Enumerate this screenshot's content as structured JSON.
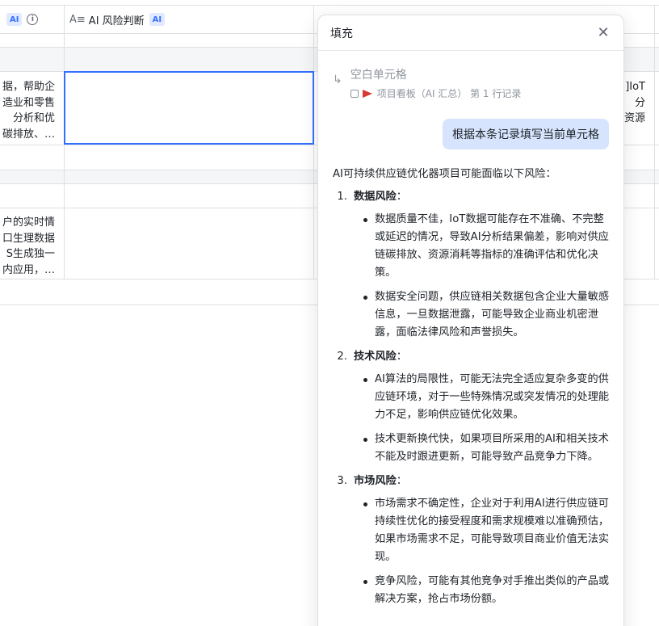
{
  "table": {
    "columns": [
      {
        "label": "",
        "badge": "AI"
      },
      {
        "label": "AI 风险判断",
        "badge": "AI"
      }
    ],
    "rows": [
      {
        "col1_lines": [
          "据，帮助企",
          "造业和零售",
          "分析和优",
          "碳排放、…"
        ],
        "col_right_lines": [
          "]IoT",
          "分",
          "资源"
        ]
      },
      {
        "col1_lines": [
          "户的实时情",
          "口生理数据",
          "S生成独一",
          "内应用，…"
        ]
      }
    ]
  },
  "panel": {
    "title": "填充",
    "reference": {
      "title": "空白单元格",
      "source": "项目看板（AI 汇总）  第 1 行记录"
    },
    "user_message": "根据本条记录填写当前单元格",
    "answer": {
      "intro": "AI可持续供应链优化器项目可能面临以下风险：",
      "sections": [
        {
          "num": "1.",
          "title": "数据风险",
          "colon": "：",
          "bullets": [
            "数据质量不佳，IoT数据可能存在不准确、不完整或延迟的情况，导致AI分析结果偏差，影响对供应链碳排放、资源消耗等指标的准确评估和优化决策。",
            "数据安全问题，供应链相关数据包含企业大量敏感信息，一旦数据泄露，可能导致企业商业机密泄露，面临法律风险和声誉损失。"
          ]
        },
        {
          "num": "2.",
          "title": "技术风险",
          "colon": "：",
          "bullets": [
            "AI算法的局限性，可能无法完全适应复杂多变的供应链环境，对于一些特殊情况或突发情况的处理能力不足，影响供应链优化效果。",
            "技术更新换代快，如果项目所采用的AI和相关技术不能及时跟进更新，可能导致产品竞争力下降。"
          ]
        },
        {
          "num": "3.",
          "title": "市场风险",
          "colon": "：",
          "bullets": [
            "市场需求不确定性，企业对于利用AI进行供应链可持续性优化的接受程度和需求规模难以准确预估，如果市场需求不足，可能导致项目商业价值无法实现。",
            "竞争风险，可能有其他竞争对手推出类似的产品或解决方案，抢占市场份额。"
          ]
        }
      ]
    }
  },
  "colors": {
    "accent": "#3370ff",
    "bubble": "#d6e4fd",
    "flag": "#d83931"
  }
}
